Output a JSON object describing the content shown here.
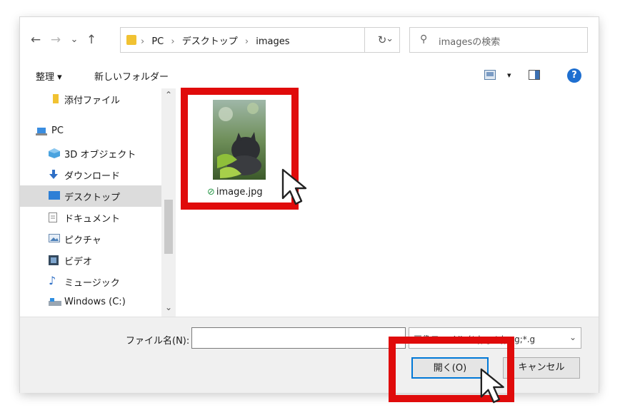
{
  "address": {
    "nav_back": "←",
    "nav_forward": "→",
    "nav_recent": "⌄",
    "nav_up": "↑",
    "crumbs": [
      "PC",
      "デスクトップ",
      "images"
    ],
    "separator": "›",
    "refresh": "↻"
  },
  "search": {
    "placeholder": "imagesの検索"
  },
  "toolbar": {
    "organize": "整理 ▾",
    "new_folder": "新しいフォルダー",
    "view_dropdown": "▾",
    "help": "?"
  },
  "nav": {
    "items": [
      {
        "label": "添付ファイル",
        "icon": "folder-icon"
      },
      {
        "label": "PC",
        "icon": "pc-icon"
      },
      {
        "label": "3D オブジェクト",
        "icon": "cube-icon"
      },
      {
        "label": "ダウンロード",
        "icon": "download-icon"
      },
      {
        "label": "デスクトップ",
        "icon": "desktop-icon",
        "selected": true
      },
      {
        "label": "ドキュメント",
        "icon": "document-icon"
      },
      {
        "label": "ピクチャ",
        "icon": "pictures-icon"
      },
      {
        "label": "ビデオ",
        "icon": "video-icon"
      },
      {
        "label": "ミュージック",
        "icon": "music-icon"
      },
      {
        "label": "Windows (C:)",
        "icon": "drive-icon"
      }
    ]
  },
  "files": [
    {
      "name": "image.jpg",
      "check": "⊘"
    }
  ],
  "bottom": {
    "filename_label": "ファイル名(N):",
    "filename_value": "",
    "filetype": "画像ファイル (*.jpg;*.jpeg;*.g",
    "open": "開く(O)",
    "cancel": "キャンセル"
  },
  "colors": {
    "highlight": "#e00b0b",
    "accent": "#0078d7",
    "selected_bg": "#dcdcdc"
  }
}
